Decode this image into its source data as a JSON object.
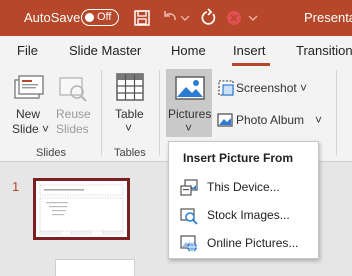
{
  "titlebar": {
    "autosave_label": "AutoSave",
    "toggle_state": "Off",
    "doc_title": "Presentat",
    "icons": [
      "save-icon",
      "undo-icon",
      "redo-icon",
      "record-icon"
    ]
  },
  "tabs": [
    {
      "label": "File"
    },
    {
      "label": "Slide Master"
    },
    {
      "label": "Home"
    },
    {
      "label": "Insert",
      "active": true
    },
    {
      "label": "Transitions"
    }
  ],
  "ribbon": {
    "new_slide": {
      "line1": "New",
      "line2": "Slide ˅"
    },
    "reuse_slides": {
      "line1": "Reuse",
      "line2": "Slides"
    },
    "table": {
      "line1": "Table",
      "line2": "˅"
    },
    "pictures": {
      "line1": "Pictures",
      "line2": "˅"
    },
    "screenshot": "Screenshot ˅",
    "photo_album": "Photo Album",
    "photo_album_arrow": "˅",
    "groups": {
      "slides": "Slides",
      "tables": "Tables"
    }
  },
  "slide_pane": {
    "slide_number": "1"
  },
  "menu": {
    "title": "Insert Picture From",
    "items": [
      {
        "label": "This Device...",
        "icon": "device-picture-icon"
      },
      {
        "label": "Stock Images...",
        "icon": "stock-images-icon"
      },
      {
        "label": "Online Pictures...",
        "icon": "online-pictures-icon"
      }
    ]
  },
  "colors": {
    "brand": "#b7472a",
    "accent_blue": "#2b7cd3",
    "selected_thumb": "#7a1f22"
  }
}
